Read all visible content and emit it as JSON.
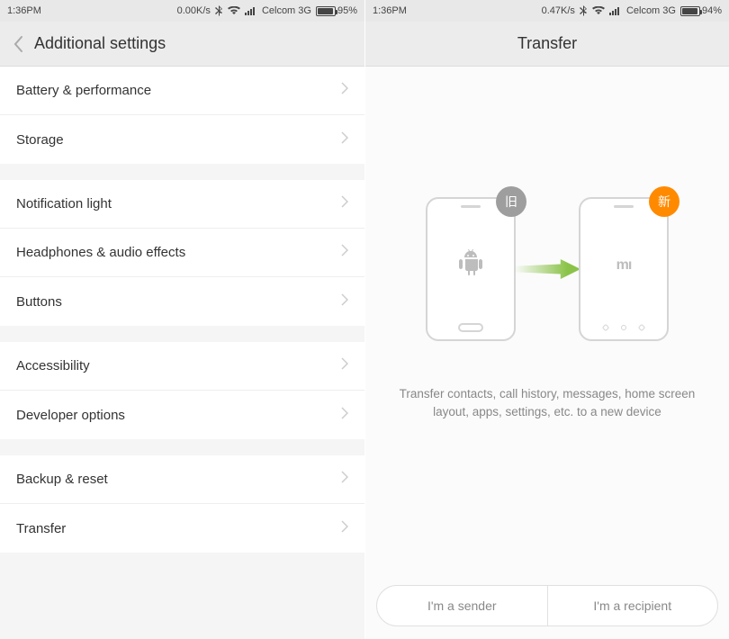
{
  "left": {
    "status": {
      "time": "1:36PM",
      "speed": "0.00K/s",
      "carrier": "Celcom 3G",
      "battery_pct": "95%",
      "battery_fill": 95
    },
    "title": "Additional settings",
    "groups": [
      [
        {
          "label": "Battery & performance"
        },
        {
          "label": "Storage"
        }
      ],
      [
        {
          "label": "Notification light"
        },
        {
          "label": "Headphones & audio effects"
        },
        {
          "label": "Buttons"
        }
      ],
      [
        {
          "label": "Accessibility"
        },
        {
          "label": "Developer options"
        }
      ],
      [
        {
          "label": "Backup & reset"
        },
        {
          "label": "Transfer"
        }
      ]
    ]
  },
  "right": {
    "status": {
      "time": "1:36PM",
      "speed": "0.47K/s",
      "carrier": "Celcom 3G",
      "battery_pct": "94%",
      "battery_fill": 94
    },
    "title": "Transfer",
    "badge_old": "旧",
    "badge_new": "新",
    "mi_label": "mı",
    "description": "Transfer contacts, call history, messages, home screen layout, apps, settings, etc. to a new device",
    "btn_sender": "I'm a sender",
    "btn_recipient": "I'm a recipient"
  }
}
